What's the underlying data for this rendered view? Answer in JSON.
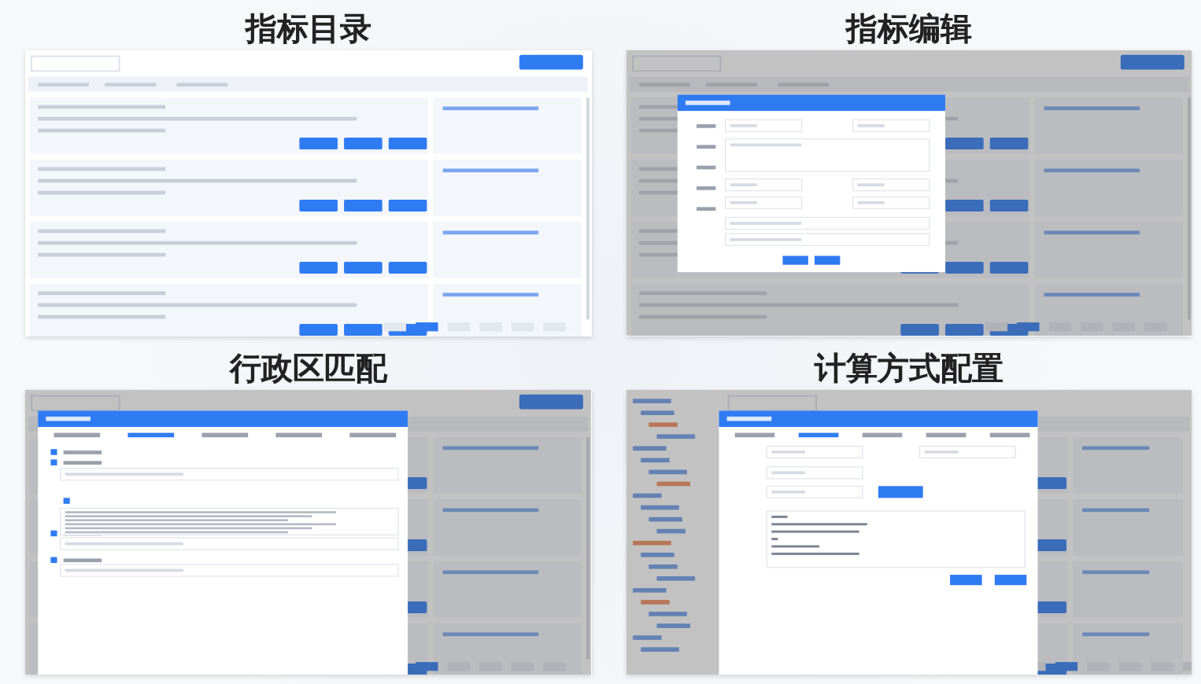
{
  "panels": [
    {
      "title": "指标目录",
      "kind": "list"
    },
    {
      "title": "指标编辑",
      "kind": "edit"
    },
    {
      "title": "行政区匹配",
      "kind": "region"
    },
    {
      "title": "计算方式配置",
      "kind": "calc"
    }
  ]
}
